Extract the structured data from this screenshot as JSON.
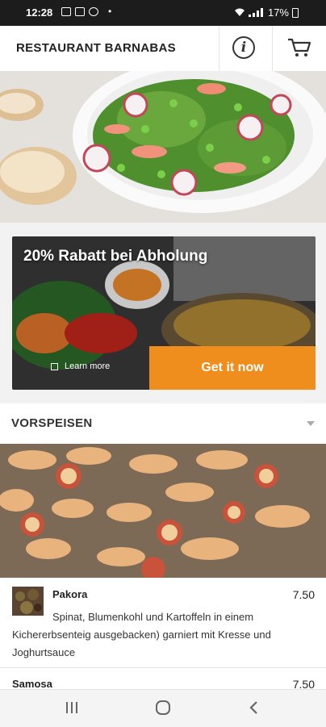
{
  "status_bar": {
    "time": "12:28",
    "dot": "•",
    "battery": "17%",
    "icons": [
      "photo-icon",
      "youtube-icon",
      "app-icon"
    ]
  },
  "app_bar": {
    "title": "RESTAURANT BARNABAS",
    "info_label": "i"
  },
  "promo": {
    "title": "20% Rabatt bei Abholung",
    "learn_more": "Learn more",
    "cta": "Get it now",
    "accent": "#ef8e1c"
  },
  "category": {
    "label": "VORSPEISEN"
  },
  "items": [
    {
      "name": "Pakora",
      "price": "7.50",
      "description": "Spinat, Blumenkohl und Kartoffeln in einem Kichererbsenteig ausgebacken) garniert mit Kresse und Joghurtsauce"
    },
    {
      "name": "Samosa",
      "price": "7.50"
    }
  ]
}
